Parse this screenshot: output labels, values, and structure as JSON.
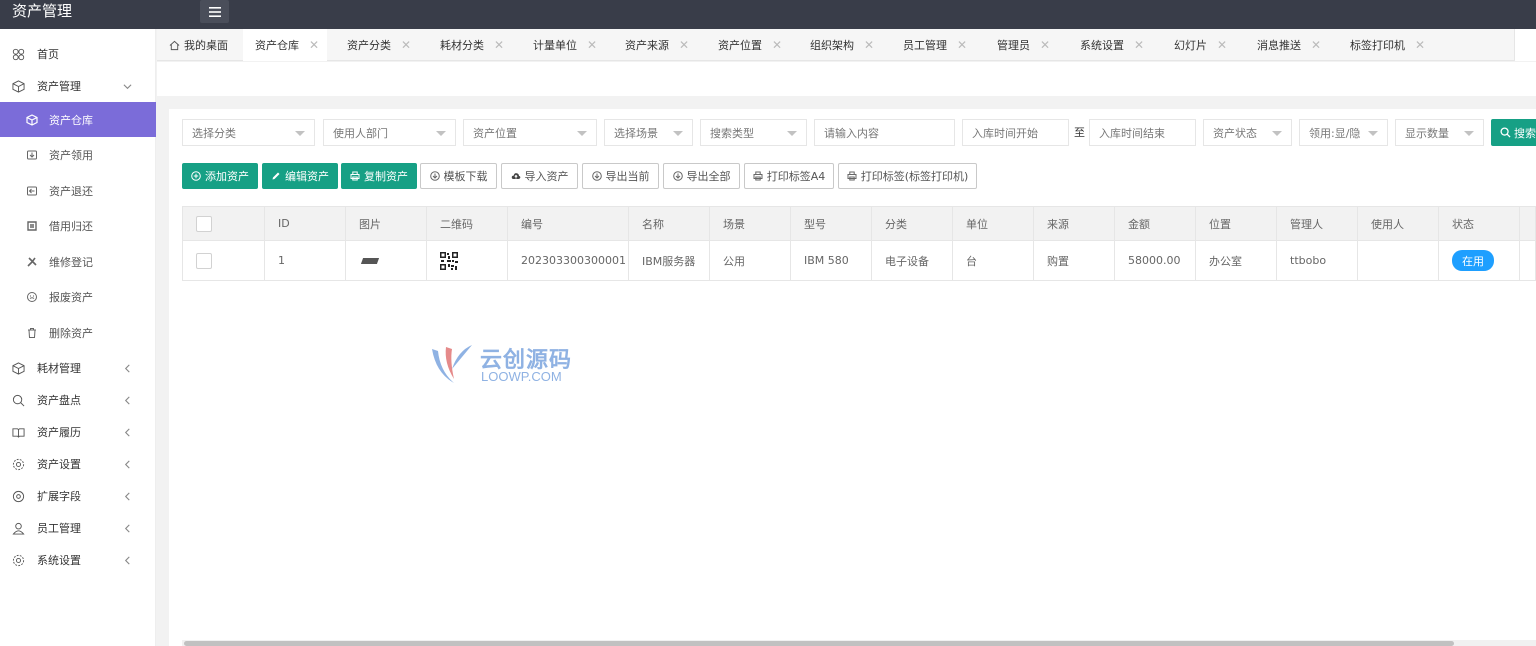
{
  "header": {
    "title": "资产管理"
  },
  "sidebar": {
    "items": [
      {
        "label": "首页",
        "icon": "home-icon"
      },
      {
        "label": "资产管理",
        "icon": "cube-icon",
        "expanded": true,
        "children": [
          {
            "label": "资产仓库",
            "icon": "box-icon",
            "active": true
          },
          {
            "label": "资产领用",
            "icon": "receive-icon"
          },
          {
            "label": "资产退还",
            "icon": "return-icon"
          },
          {
            "label": "借用归还",
            "icon": "borrow-icon"
          },
          {
            "label": "维修登记",
            "icon": "wrench-icon"
          },
          {
            "label": "报废资产",
            "icon": "scrap-icon"
          },
          {
            "label": "删除资产",
            "icon": "trash-icon"
          }
        ]
      },
      {
        "label": "耗材管理",
        "icon": "cube-icon"
      },
      {
        "label": "资产盘点",
        "icon": "search-icon"
      },
      {
        "label": "资产履历",
        "icon": "book-icon"
      },
      {
        "label": "资产设置",
        "icon": "gear-icon"
      },
      {
        "label": "扩展字段",
        "icon": "extend-icon"
      },
      {
        "label": "员工管理",
        "icon": "user-icon"
      },
      {
        "label": "系统设置",
        "icon": "gear-icon"
      }
    ]
  },
  "tabs": [
    {
      "label": "我的桌面",
      "icon": "home-icon"
    },
    {
      "label": "资产仓库",
      "active": true
    },
    {
      "label": "资产分类"
    },
    {
      "label": "耗材分类"
    },
    {
      "label": "计量单位"
    },
    {
      "label": "资产来源"
    },
    {
      "label": "资产位置"
    },
    {
      "label": "组织架构"
    },
    {
      "label": "员工管理"
    },
    {
      "label": "管理员"
    },
    {
      "label": "系统设置"
    },
    {
      "label": "幻灯片"
    },
    {
      "label": "消息推送"
    },
    {
      "label": "标签打印机"
    }
  ],
  "filters": {
    "category": "选择分类",
    "department": "使用人部门",
    "location": "资产位置",
    "scene": "选择场景",
    "search_type": "搜索类型",
    "keyword_placeholder": "请输入内容",
    "date_start": "入库时间开始",
    "to": "至",
    "date_end": "入库时间结束",
    "status": "资产状态",
    "receive": "领用:显/隐",
    "page_size": "显示数量",
    "search": "搜索"
  },
  "toolbar": {
    "add": "添加资产",
    "edit": "编辑资产",
    "copy": "复制资产",
    "template": "模板下载",
    "import": "导入资产",
    "export_current": "导出当前",
    "export_all": "导出全部",
    "print_a4": "打印标签A4",
    "print_label": "打印标签(标签打印机)"
  },
  "table": {
    "columns": [
      "ID",
      "图片",
      "二维码",
      "编号",
      "名称",
      "场景",
      "型号",
      "分类",
      "单位",
      "来源",
      "金额",
      "位置",
      "管理人",
      "使用人",
      "状态"
    ],
    "rows": [
      {
        "id": "1",
        "code": "202303300300001",
        "name": "IBM服务器",
        "scene": "公用",
        "model": "IBM 580",
        "category": "电子设备",
        "unit": "台",
        "source": "购置",
        "amount": "58000.00",
        "location": "办公室",
        "manager": "ttbobo",
        "user": "",
        "status": "在用"
      }
    ]
  },
  "watermark": {
    "cn": "云创源码",
    "en": "LOOWP.COM"
  },
  "colors": {
    "header": "#393d49",
    "accent": "#7b6cd9",
    "primary": "#16a085",
    "badge": "#1e9fff"
  }
}
